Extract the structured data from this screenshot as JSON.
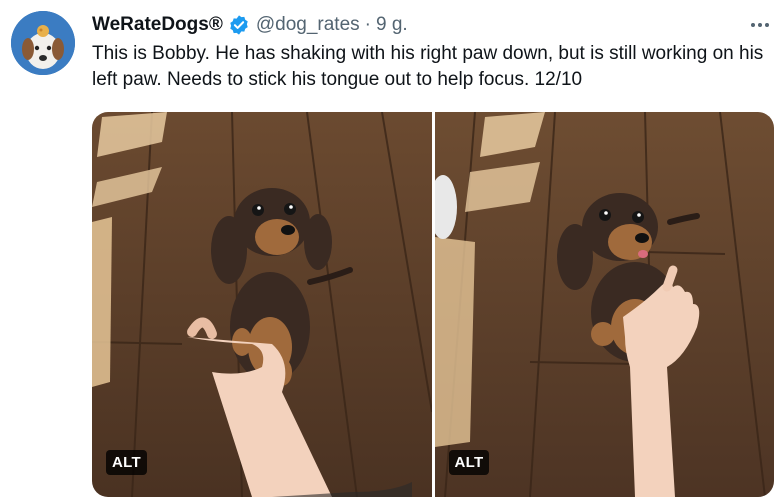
{
  "tweet": {
    "author_name": "WeRateDogs®",
    "handle": "@dog_rates",
    "separator": "·",
    "time": "9 g.",
    "text": "This is Bobby. He has shaking with his right paw down, but is still working on his left paw. Needs to stick his tongue out to help focus. 12/10",
    "verified_color": "#1d9bf0",
    "more_icon": "more-horizontal-icon"
  },
  "media": {
    "photos": [
      {
        "alt_badge": "ALT"
      },
      {
        "alt_badge": "ALT"
      }
    ]
  }
}
